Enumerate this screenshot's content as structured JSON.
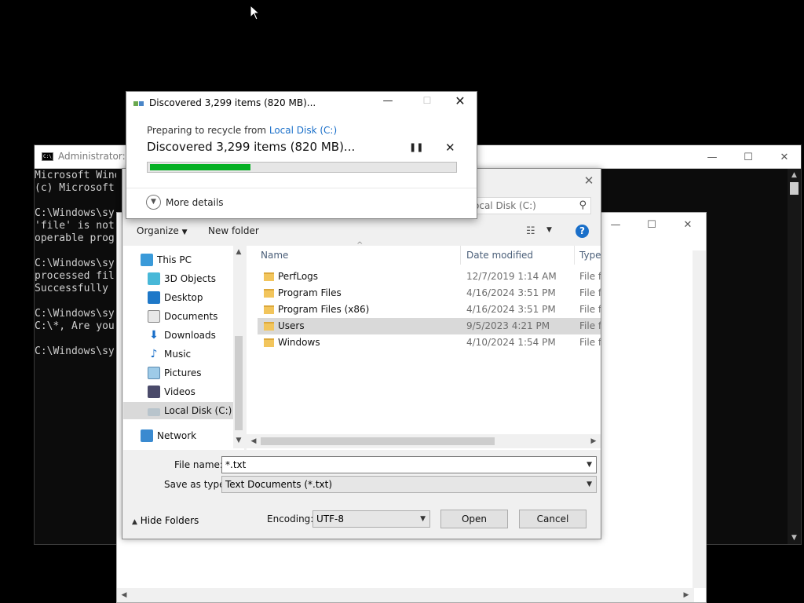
{
  "cmd": {
    "title": "Administrator: C",
    "lines": "Microsoft Wind\n(c) Microsoft\n\nC:\\Windows\\sy\n'file' is not\noperable prog\n\nC:\\Windows\\sy\nprocessed fil\nSuccessfully\n\nC:\\Windows\\sy\nC:\\*, Are you\n\nC:\\Windows\\sy",
    "icon_text": "C:\\"
  },
  "save_dialog": {
    "search_placeholder": "ocal Disk (C:)",
    "toolbar": {
      "organize": "Organize",
      "new_folder": "New folder"
    },
    "nav": [
      {
        "label": "This PC",
        "icon": "this-pc-icon"
      },
      {
        "label": "3D Objects",
        "icon": "3d-objects-icon"
      },
      {
        "label": "Desktop",
        "icon": "desktop-icon"
      },
      {
        "label": "Documents",
        "icon": "documents-icon"
      },
      {
        "label": "Downloads",
        "icon": "downloads-icon"
      },
      {
        "label": "Music",
        "icon": "music-icon"
      },
      {
        "label": "Pictures",
        "icon": "pictures-icon"
      },
      {
        "label": "Videos",
        "icon": "videos-icon"
      },
      {
        "label": "Local Disk (C:)",
        "icon": "local-disk-icon"
      },
      {
        "label": "Network",
        "icon": "network-icon"
      }
    ],
    "columns": {
      "name": "Name",
      "date": "Date modified",
      "type": "Type"
    },
    "files": [
      {
        "name": "PerfLogs",
        "date": "12/7/2019 1:14 AM",
        "type": "File fo"
      },
      {
        "name": "Program Files",
        "date": "4/16/2024 3:51 PM",
        "type": "File fo"
      },
      {
        "name": "Program Files (x86)",
        "date": "4/16/2024 3:51 PM",
        "type": "File fo"
      },
      {
        "name": "Users",
        "date": "9/5/2023 4:21 PM",
        "type": "File fo"
      },
      {
        "name": "Windows",
        "date": "4/10/2024 1:54 PM",
        "type": "File fo"
      }
    ],
    "file_name_label": "File name:",
    "file_name_value": "*.txt",
    "save_type_label": "Save as type:",
    "save_type_value": "Text Documents (*.txt)",
    "hide_folders": "Hide Folders",
    "encoding_label": "Encoding:",
    "encoding_value": "UTF-8",
    "open_button": "Open",
    "cancel_button": "Cancel"
  },
  "progress_dialog": {
    "title": "Discovered 3,299 items (820 MB)...",
    "preparing": "Preparing to recycle from ",
    "source_link": "Local Disk (C:)",
    "status": "Discovered 3,299 items (820 MB)...",
    "progress_fraction": 0.33,
    "more_details": "More details",
    "accent_color": "#06b025"
  }
}
